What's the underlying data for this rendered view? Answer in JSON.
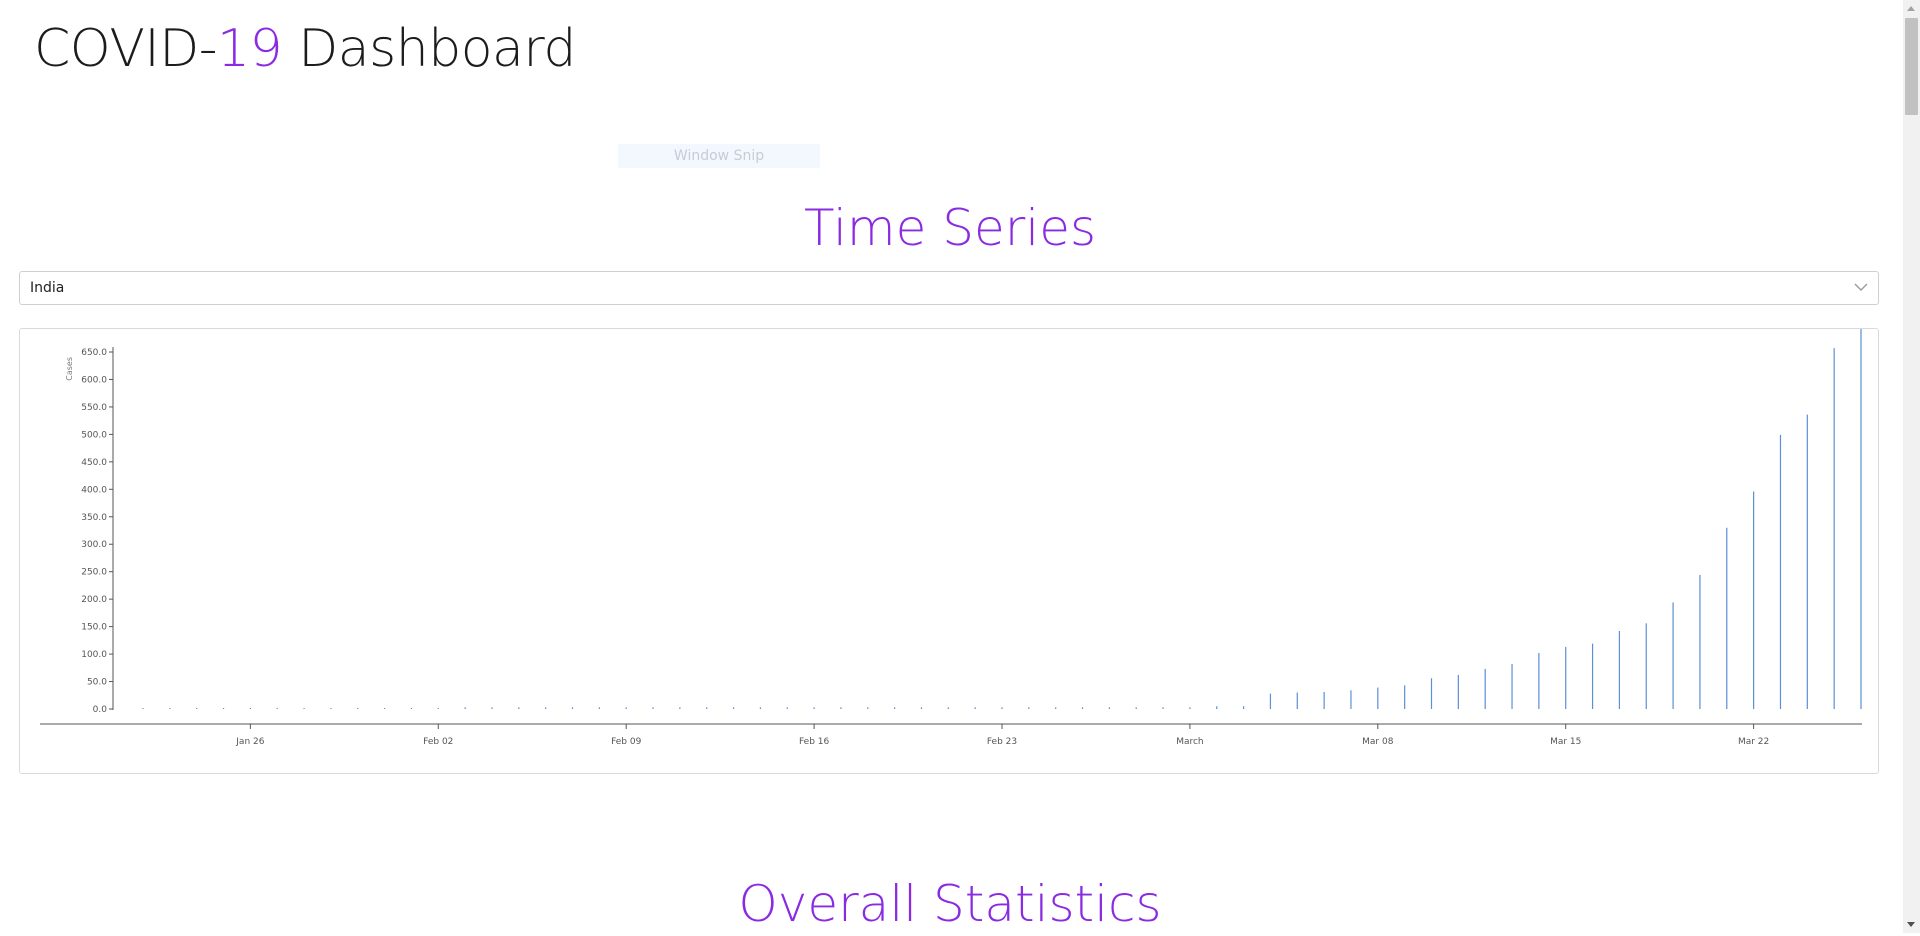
{
  "header": {
    "title_prefix": "COVID-",
    "title_accent": "19",
    "title_suffix": " Dashboard"
  },
  "overlay": {
    "snip_label": "Window Snip"
  },
  "time_series": {
    "title": "Time Series",
    "country_select": {
      "value": "India"
    }
  },
  "overall": {
    "title": "Overall Statistics"
  },
  "colors": {
    "accent": "#8a2be2",
    "bar": "#5b8fd6",
    "axis": "#555555"
  },
  "chart_data": {
    "type": "bar",
    "ylabel": "Cases",
    "xlabel": "",
    "ylim": [
      0,
      650
    ],
    "yticks": [
      "0.0",
      "50.0",
      "100.0",
      "150.0",
      "200.0",
      "250.0",
      "300.0",
      "350.0",
      "400.0",
      "450.0",
      "500.0",
      "550.0",
      "600.0",
      "650.0"
    ],
    "xticks": [
      {
        "label": "Jan 26",
        "date": "2020-01-26"
      },
      {
        "label": "Feb 02",
        "date": "2020-02-02"
      },
      {
        "label": "Feb 09",
        "date": "2020-02-09"
      },
      {
        "label": "Feb 16",
        "date": "2020-02-16"
      },
      {
        "label": "Feb 23",
        "date": "2020-02-23"
      },
      {
        "label": "March",
        "date": "2020-03-01"
      },
      {
        "label": "Mar 08",
        "date": "2020-03-08"
      },
      {
        "label": "Mar 15",
        "date": "2020-03-15"
      },
      {
        "label": "Mar 22",
        "date": "2020-03-22"
      }
    ],
    "x": [
      "2020-01-22",
      "2020-01-23",
      "2020-01-24",
      "2020-01-25",
      "2020-01-26",
      "2020-01-27",
      "2020-01-28",
      "2020-01-29",
      "2020-01-30",
      "2020-01-31",
      "2020-02-01",
      "2020-02-02",
      "2020-02-03",
      "2020-02-04",
      "2020-02-05",
      "2020-02-06",
      "2020-02-07",
      "2020-02-08",
      "2020-02-09",
      "2020-02-10",
      "2020-02-11",
      "2020-02-12",
      "2020-02-13",
      "2020-02-14",
      "2020-02-15",
      "2020-02-16",
      "2020-02-17",
      "2020-02-18",
      "2020-02-19",
      "2020-02-20",
      "2020-02-21",
      "2020-02-22",
      "2020-02-23",
      "2020-02-24",
      "2020-02-25",
      "2020-02-26",
      "2020-02-27",
      "2020-02-28",
      "2020-02-29",
      "2020-03-01",
      "2020-03-02",
      "2020-03-03",
      "2020-03-04",
      "2020-03-05",
      "2020-03-06",
      "2020-03-07",
      "2020-03-08",
      "2020-03-09",
      "2020-03-10",
      "2020-03-11",
      "2020-03-12",
      "2020-03-13",
      "2020-03-14",
      "2020-03-15",
      "2020-03-16",
      "2020-03-17",
      "2020-03-18",
      "2020-03-19",
      "2020-03-20",
      "2020-03-21",
      "2020-03-22",
      "2020-03-23",
      "2020-03-24",
      "2020-03-25",
      "2020-03-26"
    ],
    "values": [
      0,
      0,
      0,
      0,
      0,
      0,
      0,
      0,
      1,
      1,
      1,
      2,
      3,
      3,
      3,
      3,
      3,
      3,
      3,
      3,
      3,
      3,
      3,
      3,
      3,
      3,
      3,
      3,
      3,
      3,
      3,
      3,
      3,
      3,
      3,
      3,
      3,
      3,
      3,
      3,
      5,
      5,
      28,
      30,
      31,
      34,
      39,
      43,
      56,
      62,
      73,
      82,
      102,
      113,
      119,
      142,
      156,
      194,
      244,
      330,
      396,
      499,
      536,
      657,
      727
    ],
    "series": [
      {
        "values_ref": "values"
      }
    ]
  }
}
